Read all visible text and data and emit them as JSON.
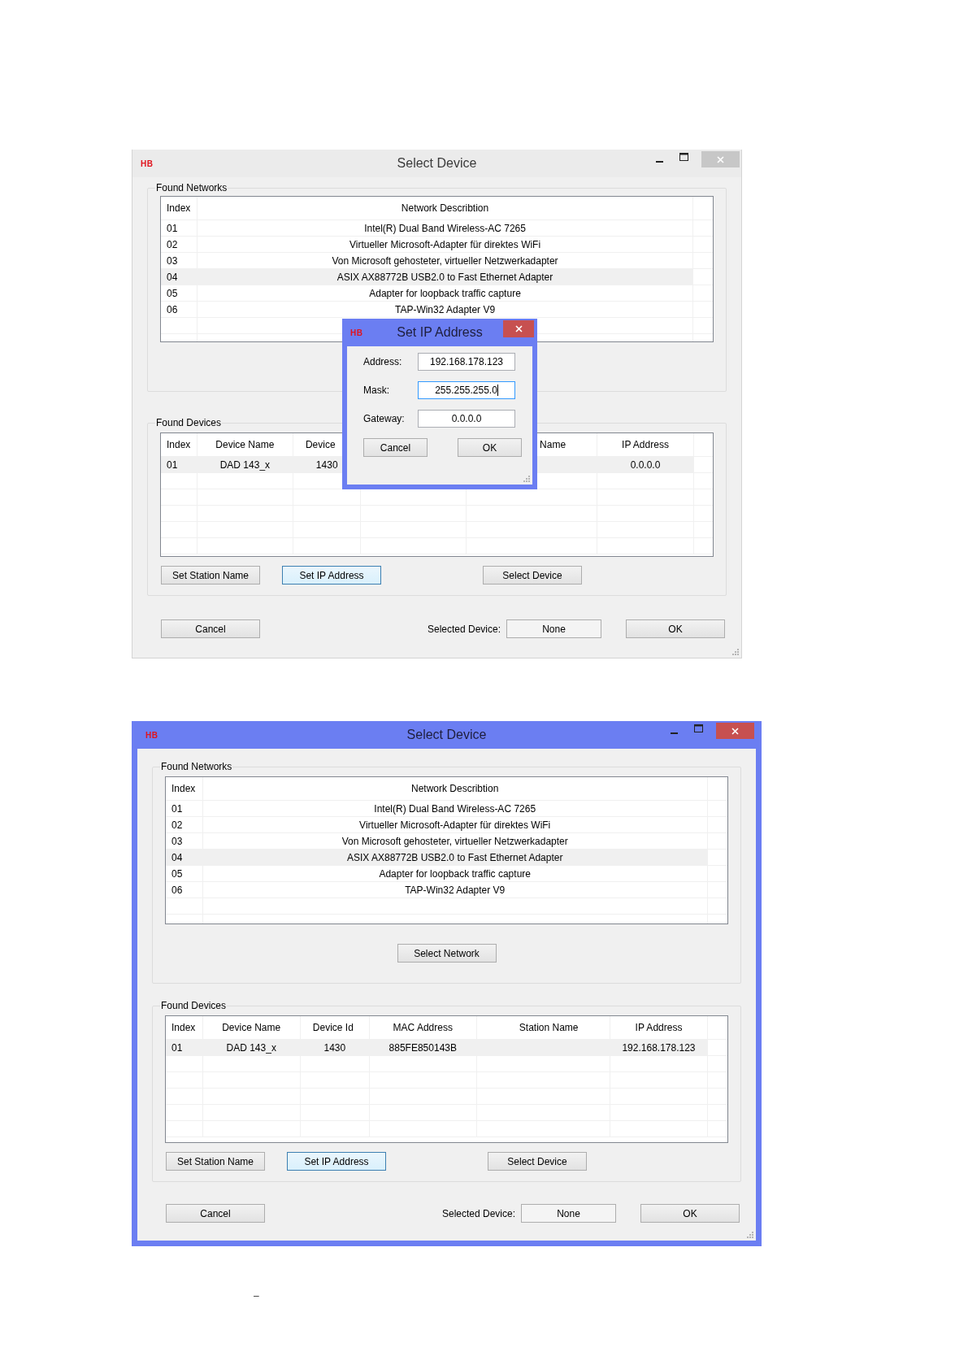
{
  "windows": [
    {
      "active": false,
      "logo": "HB",
      "title": "Select Device",
      "networks": {
        "label": "Found Networks",
        "columns": {
          "index": "Index",
          "description": "Network Describtion"
        },
        "rows": [
          {
            "index": "01",
            "description": "Intel(R) Dual Band Wireless-AC 7265",
            "selected": false
          },
          {
            "index": "02",
            "description": "Virtueller Microsoft-Adapter für direktes WiFi",
            "selected": false
          },
          {
            "index": "03",
            "description": "Von Microsoft gehosteter, virtueller Netzwerkadapter",
            "selected": false
          },
          {
            "index": "04",
            "description": "ASIX AX88772B USB2.0 to Fast Ethernet Adapter",
            "selected": true
          },
          {
            "index": "05",
            "description": "Adapter for loopback traffic capture",
            "selected": false
          },
          {
            "index": "06",
            "description": "TAP-Win32 Adapter V9",
            "selected": false
          }
        ]
      },
      "devices": {
        "label": "Found Devices",
        "columns": {
          "index": "Index",
          "device_name": "Device Name",
          "device_id": "Device",
          "station_name": "Name",
          "ip_address": "IP Address"
        },
        "rows": [
          {
            "index": "01",
            "device_name": "DAD 143_x",
            "device_id": "1430",
            "ip_address": "0.0.0.0",
            "selected": true
          }
        ],
        "buttons": [
          {
            "label": "Set Station Name",
            "focused": false
          },
          {
            "label": "Set IP Address",
            "focused": true
          },
          {
            "label": "Select Device",
            "focused": false
          }
        ]
      },
      "selected_device_label": "Selected Device:",
      "selected_device": "None",
      "buttons": [
        {
          "label": "Cancel",
          "focused": false
        },
        {
          "label": "OK",
          "focused": false
        }
      ],
      "dialog": {
        "active": true,
        "logo": "HB",
        "title": "Set IP Address",
        "fields": [
          {
            "label": "Address:",
            "value": "192.168.178.123",
            "focused": false
          },
          {
            "label": "Mask:",
            "value": "255.255.255.0",
            "focused": true
          },
          {
            "label": "Gateway:",
            "value": "0.0.0.0",
            "focused": false
          }
        ],
        "buttons": [
          {
            "label": "Cancel",
            "focused": false
          },
          {
            "label": "OK",
            "focused": false
          }
        ]
      }
    },
    {
      "active": true,
      "logo": "HB",
      "title": "Select Device",
      "networks": {
        "label": "Found Networks",
        "columns": {
          "index": "Index",
          "description": "Network Describtion"
        },
        "rows": [
          {
            "index": "01",
            "description": "Intel(R) Dual Band Wireless-AC 7265",
            "selected": false
          },
          {
            "index": "02",
            "description": "Virtueller Microsoft-Adapter für direktes WiFi",
            "selected": false
          },
          {
            "index": "03",
            "description": "Von Microsoft gehosteter, virtueller Netzwerkadapter",
            "selected": false
          },
          {
            "index": "04",
            "description": "ASIX AX88772B USB2.0 to Fast Ethernet Adapter",
            "selected": true
          },
          {
            "index": "05",
            "description": "Adapter for loopback traffic capture",
            "selected": false
          },
          {
            "index": "06",
            "description": "TAP-Win32 Adapter V9",
            "selected": false
          }
        ],
        "button": {
          "label": "Select Network",
          "focused": false
        }
      },
      "devices": {
        "label": "Found Devices",
        "columns": {
          "index": "Index",
          "device_name": "Device Name",
          "device_id": "Device Id",
          "mac_address": "MAC Address",
          "station_name": "Station Name",
          "ip_address": "IP Address"
        },
        "rows": [
          {
            "index": "01",
            "device_name": "DAD 143_x",
            "device_id": "1430",
            "mac_address": "885FE850143B",
            "ip_address": "192.168.178.123",
            "selected": true
          }
        ],
        "buttons": [
          {
            "label": "Set Station Name",
            "focused": false
          },
          {
            "label": "Set IP Address",
            "focused": true
          },
          {
            "label": "Select Device",
            "focused": false
          }
        ]
      },
      "selected_device_label": "Selected Device:",
      "selected_device": "None",
      "buttons": [
        {
          "label": "Cancel",
          "focused": false
        },
        {
          "label": "OK",
          "focused": false
        }
      ]
    }
  ],
  "page_mark": "–"
}
